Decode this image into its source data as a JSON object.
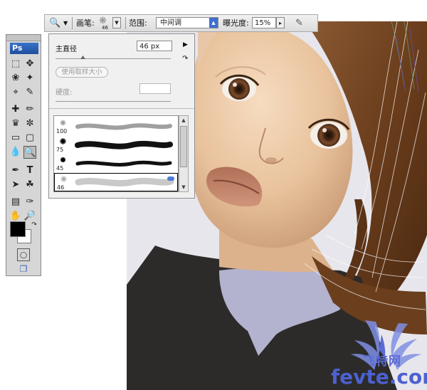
{
  "options_bar": {
    "brush_label": "画笔:",
    "brush_size": "46",
    "range_label": "范围:",
    "range_value": "中间调",
    "exposure_label": "曝光度:",
    "exposure_value": "15%",
    "icons": [
      "magnifier-tool-icon",
      "chevron-down-icon",
      "airbrush-icon"
    ]
  },
  "toolbox": {
    "logo": "Ps",
    "foreground_color": "#000000",
    "background_color": "#ffffff"
  },
  "brush_popup": {
    "master_diameter_label": "主直径",
    "master_diameter_value": "46 px",
    "use_sample_size_label": "使用取样大小",
    "hardness_label": "硬度:",
    "presets": [
      {
        "size": "100"
      },
      {
        "size": "75"
      },
      {
        "size": "45"
      },
      {
        "size": "46"
      }
    ]
  },
  "watermark": {
    "cn": "飞特网",
    "en": "fevte.com"
  },
  "colors": {
    "hair": "#6b3f1e",
    "skin": "#ecc8a5",
    "collar": "#b3b3cf",
    "dress": "#2d2b2a",
    "accent_blue": "#4c61d0"
  }
}
